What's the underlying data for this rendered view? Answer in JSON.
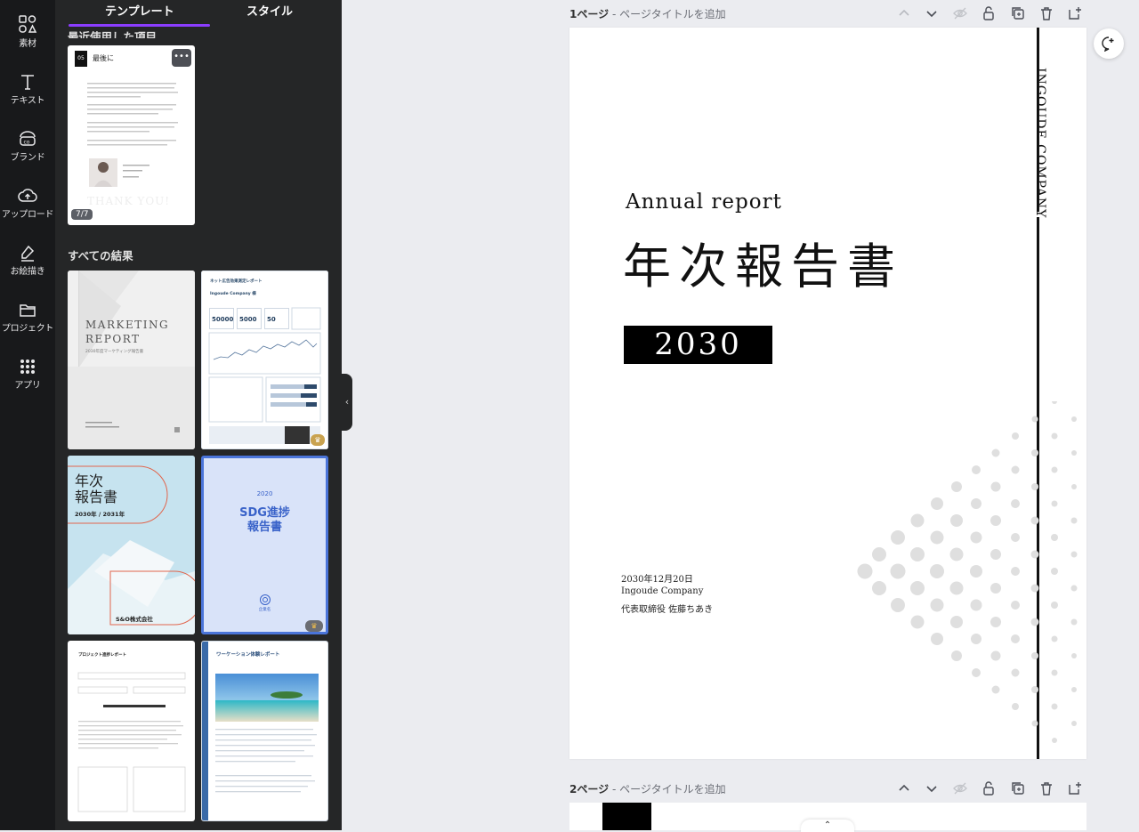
{
  "rail": [
    {
      "label": "素材",
      "icon": "elements-icon"
    },
    {
      "label": "テキスト",
      "icon": "text-icon"
    },
    {
      "label": "ブランド",
      "icon": "brand-icon"
    },
    {
      "label": "アップロード",
      "icon": "upload-icon"
    },
    {
      "label": "お絵描き",
      "icon": "draw-icon"
    },
    {
      "label": "プロジェクト",
      "icon": "folder-icon"
    },
    {
      "label": "アプリ",
      "icon": "apps-icon"
    }
  ],
  "panel": {
    "tabs": [
      "テンプレート",
      "スタイル"
    ],
    "recent_title": "最近使用した項目",
    "recent_thumb": {
      "number": "05",
      "heading": "最後に",
      "thank_you": "THANK YOU!",
      "page_count": "7/7"
    },
    "all_results_title": "すべての結果",
    "thumbs": {
      "marketing": {
        "title_line1": "MARKETING",
        "title_line2": "REPORT",
        "subtitle": "2030年度マーケティング報告書"
      },
      "kpi": {
        "title": "ネット広告効果測定レポート",
        "company": "Ingoude Company 様",
        "v1": "50000",
        "v2": "5000",
        "v3": "50"
      },
      "annual": {
        "line1": "年次",
        "line2": "報告書",
        "years": "2030年 / 2031年",
        "company": "S&O株式会社"
      },
      "sdg": {
        "year": "2020",
        "line1": "SDG進捗",
        "line2": "報告書",
        "company": "企業名"
      },
      "project": {
        "title": "プロジェクト進捗レポート"
      },
      "workation": {
        "title": "ワーケーション体験レポート"
      }
    }
  },
  "page1_header": {
    "number": "1ページ",
    "sep": " - ",
    "placeholder": "ページタイトルを追加"
  },
  "page2_header": {
    "number": "2ページ",
    "sep": " - ",
    "placeholder": "ページタイトルを追加"
  },
  "doc": {
    "company_vertical": "INGOUDE COMPANY",
    "subtitle_en": "Annual report",
    "title_ja": "年次報告書",
    "year": "2030",
    "date": "2030年12月20日",
    "company": "Ingoude Company",
    "representative": "代表取締役 佐藤ちあき"
  },
  "colors": {
    "accent": "#8b3dff",
    "panel_bg": "#252627",
    "rail_bg": "#18191b",
    "canvas_bg": "#ebecf0"
  }
}
